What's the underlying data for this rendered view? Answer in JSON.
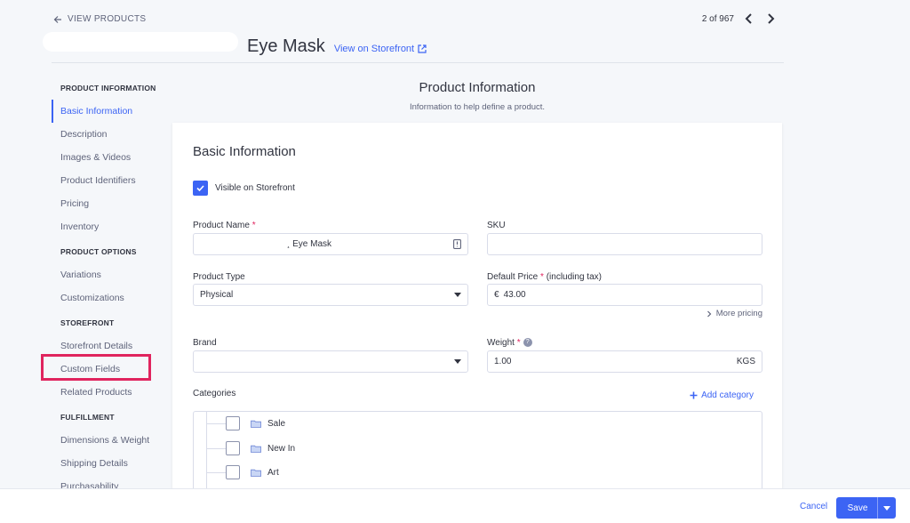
{
  "colors": {
    "accent": "#3c64f4",
    "highlight": "#e0245e",
    "background": "#f5f7fa"
  },
  "header": {
    "back_label": "VIEW PRODUCTS",
    "pager_label": "2 of 967",
    "title": "Eye Mask",
    "storefront_link": "View on Storefront"
  },
  "sidebar": {
    "sections": [
      {
        "title": "PRODUCT INFORMATION",
        "items": [
          "Basic Information",
          "Description",
          "Images & Videos",
          "Product Identifiers",
          "Pricing",
          "Inventory"
        ]
      },
      {
        "title": "PRODUCT OPTIONS",
        "items": [
          "Variations",
          "Customizations"
        ]
      },
      {
        "title": "STOREFRONT",
        "items": [
          "Storefront Details",
          "Custom Fields",
          "Related Products"
        ]
      },
      {
        "title": "FULFILLMENT",
        "items": [
          "Dimensions & Weight",
          "Shipping Details",
          "Purchasability"
        ]
      }
    ]
  },
  "main": {
    "section_title": "Product Information",
    "section_subtitle": "Information to help define a product.",
    "card_title": "Basic Information",
    "visible_label": "Visible on Storefront",
    "product_name_label": "Product Name",
    "product_name_value": "¸ Eye Mask",
    "sku_label": "SKU",
    "sku_value": "",
    "product_type_label": "Product Type",
    "product_type_value": "Physical",
    "default_price_label": "Default Price",
    "default_price_suffix": " (including tax)",
    "currency_symbol": "€",
    "default_price_value": "43.00",
    "more_pricing": "More pricing",
    "brand_label": "Brand",
    "brand_value": "",
    "weight_label": "Weight",
    "weight_value": "1.00",
    "weight_unit": "KGS",
    "categories_label": "Categories",
    "add_category": "Add category",
    "categories": [
      "Sale",
      "New In",
      "Art"
    ]
  },
  "footer": {
    "cancel": "Cancel",
    "save": "Save"
  }
}
